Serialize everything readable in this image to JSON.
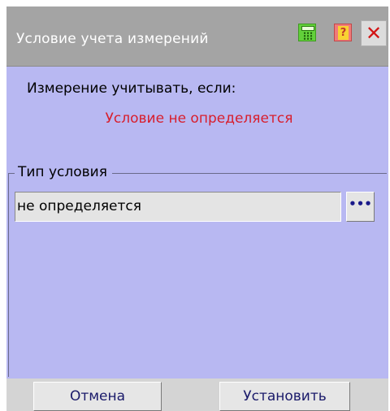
{
  "window": {
    "title": "Условие учета измерений"
  },
  "titlebar_icons": {
    "calculator": "calculator-icon",
    "help": "help-icon",
    "close": "close-icon",
    "close_glyph": "✕"
  },
  "content": {
    "prompt_label": "Измерение учитывать, если:",
    "status_text": "Условие не определяется",
    "status_color": "#d81e2c"
  },
  "condition_type": {
    "group_title": "Тип условия",
    "value": "не определяется",
    "browse_glyph": "•••"
  },
  "buttons": {
    "cancel": "Отмена",
    "apply": "Установить"
  },
  "colors": {
    "titlebar": "#a4a4a4",
    "body_background": "#b8b8f2",
    "field_background": "#e4e4e4"
  }
}
